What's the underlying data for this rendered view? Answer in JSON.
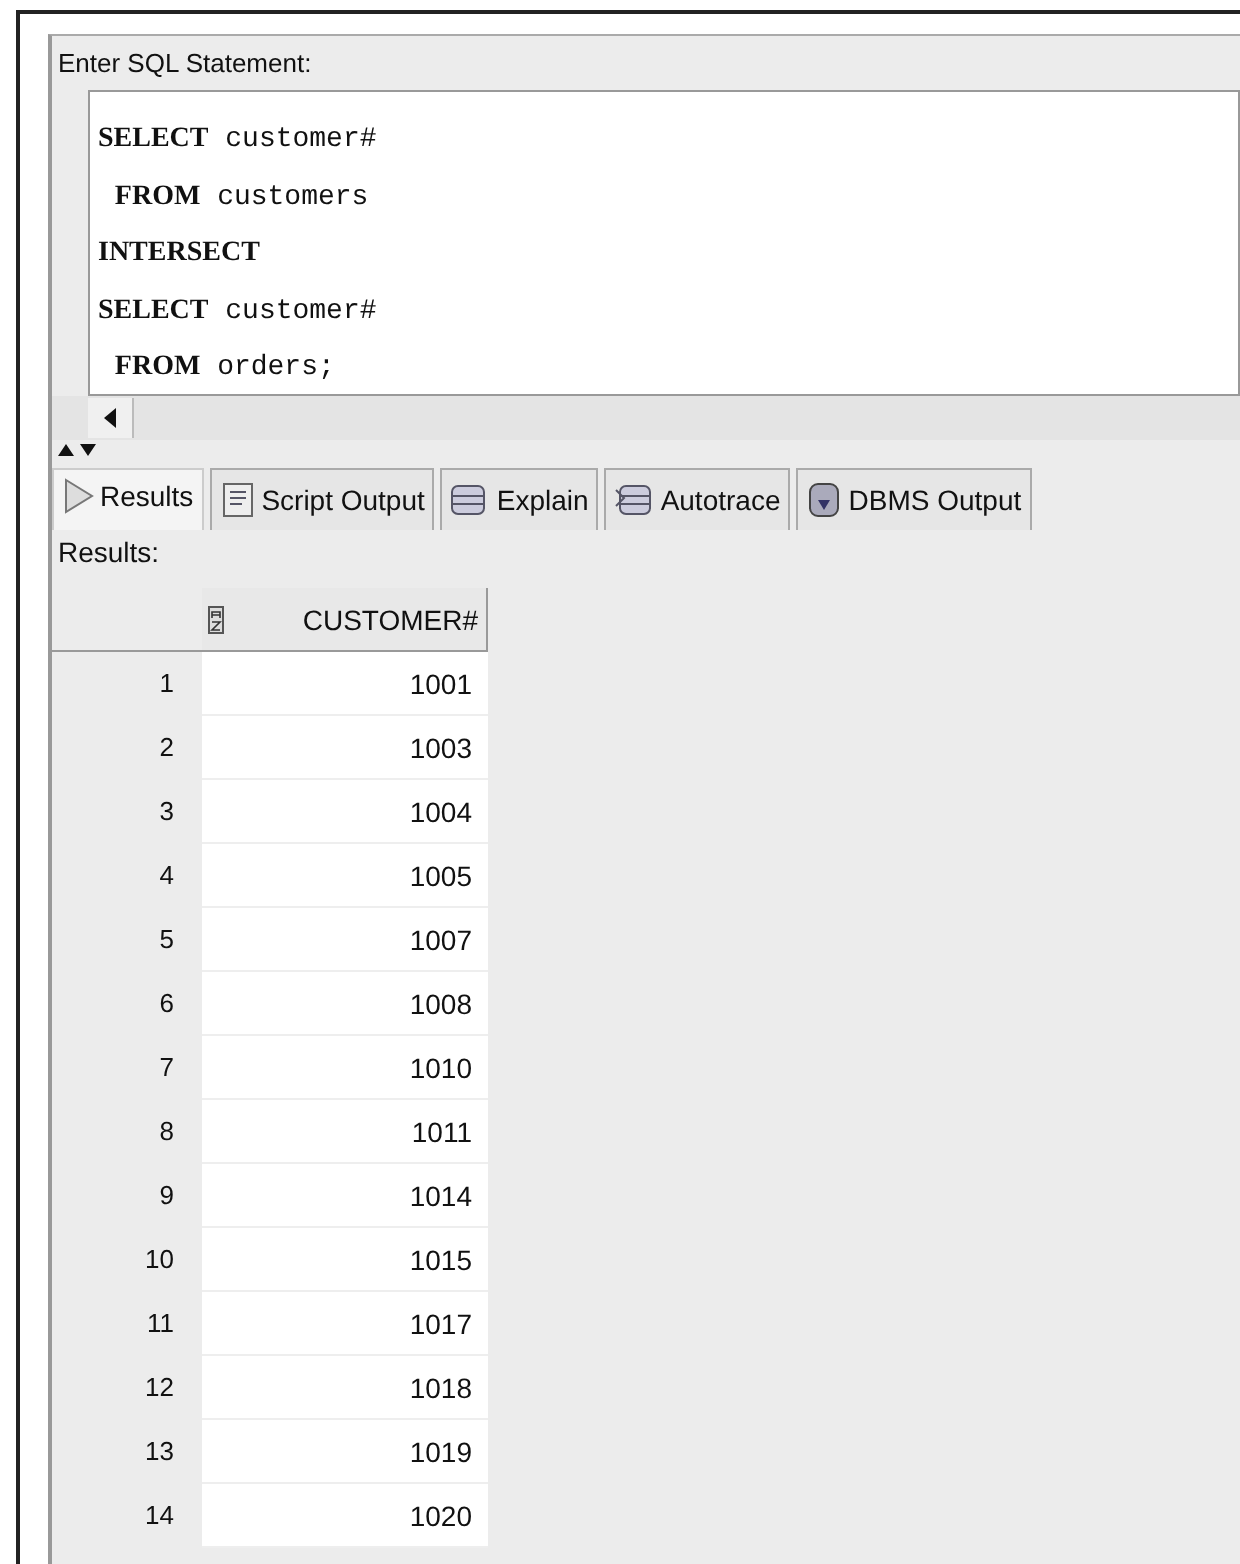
{
  "editor": {
    "label": "Enter SQL Statement:",
    "lines": [
      "**SELECT** customer#",
      " **FROM** customers",
      "**INTERSECT**",
      "**SELECT** customer#",
      " **FROM** orders;"
    ]
  },
  "tabs": [
    {
      "label": "Results",
      "kind": "play",
      "selected": true
    },
    {
      "label": "Script Output",
      "kind": "script",
      "selected": false
    },
    {
      "label": "Explain",
      "kind": "explain",
      "selected": false
    },
    {
      "label": "Autotrace",
      "kind": "autotrace",
      "selected": false
    },
    {
      "label": "DBMS Output",
      "kind": "dbms",
      "selected": false
    }
  ],
  "results": {
    "label": "Results:",
    "column": "CUSTOMER#",
    "rows": [
      {
        "n": "1",
        "value": "1001"
      },
      {
        "n": "2",
        "value": "1003"
      },
      {
        "n": "3",
        "value": "1004"
      },
      {
        "n": "4",
        "value": "1005"
      },
      {
        "n": "5",
        "value": "1007"
      },
      {
        "n": "6",
        "value": "1008"
      },
      {
        "n": "7",
        "value": "1010"
      },
      {
        "n": "8",
        "value": "1011"
      },
      {
        "n": "9",
        "value": "1014"
      },
      {
        "n": "10",
        "value": "1015"
      },
      {
        "n": "11",
        "value": "1017"
      },
      {
        "n": "12",
        "value": "1018"
      },
      {
        "n": "13",
        "value": "1019"
      },
      {
        "n": "14",
        "value": "1020"
      }
    ]
  }
}
